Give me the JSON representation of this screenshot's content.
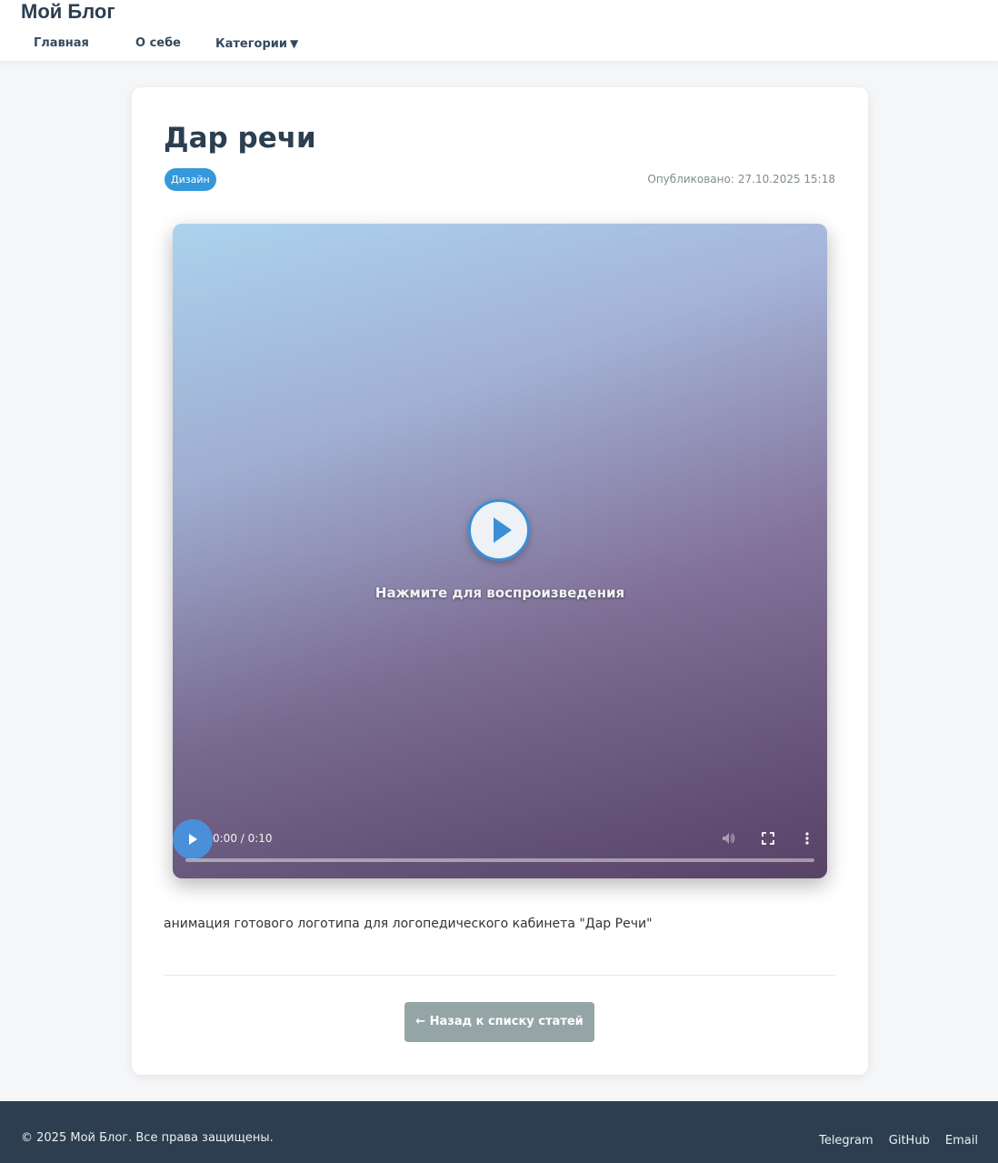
{
  "header": {
    "brand": "Мой Блог",
    "nav": {
      "home": "Главная",
      "about": "О себе",
      "categories": "Категории",
      "categories_caret": "▼"
    }
  },
  "post": {
    "title": "Дар речи",
    "tag": "Дизайн",
    "published_label": "Опубликовано:",
    "published_date": "27.10.2025 15:18",
    "video": {
      "caption": "Нажмите для воспроизведения",
      "time": "0:00 / 0:10",
      "progress": 0,
      "icons": {
        "big_play": "play-icon",
        "small_play": "play-icon",
        "volume": "volume-icon",
        "fullscreen": "fullscreen-icon",
        "more": "more-vertical-icon"
      }
    },
    "description": "анимация готового логотипа для логопедического кабинета \"Дар Речи\"",
    "back_button": "← Назад к списку статей"
  },
  "footer": {
    "copyright": "© 2025 Мой Блог. Все права защищены.",
    "links": [
      "Telegram",
      "GitHub",
      "Email"
    ]
  },
  "colors": {
    "accent": "#3498db",
    "header_text": "#2c3e50",
    "footer_bg": "#2c3e50",
    "button_bg": "#95a5a6"
  }
}
